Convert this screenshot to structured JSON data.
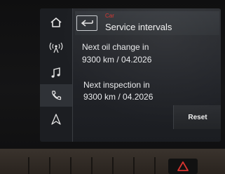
{
  "header": {
    "breadcrumb": "Car",
    "title": "Service intervals"
  },
  "sidebar": {
    "items": [
      {
        "icon": "home-icon"
      },
      {
        "icon": "radio-icon"
      },
      {
        "icon": "music-note-icon"
      },
      {
        "icon": "phone-icon",
        "active": true
      },
      {
        "icon": "navigation-icon"
      }
    ]
  },
  "main": {
    "oil_change_label": "Next oil change in",
    "oil_change_value": "9300 km / 04.2026",
    "inspection_label": "Next inspection in",
    "inspection_value": "9300 km / 04.2026"
  },
  "actions": {
    "reset_label": "Reset"
  },
  "colors": {
    "accent": "#d8342f",
    "text": "#e9eaec",
    "screen_bg": "#23252a"
  }
}
